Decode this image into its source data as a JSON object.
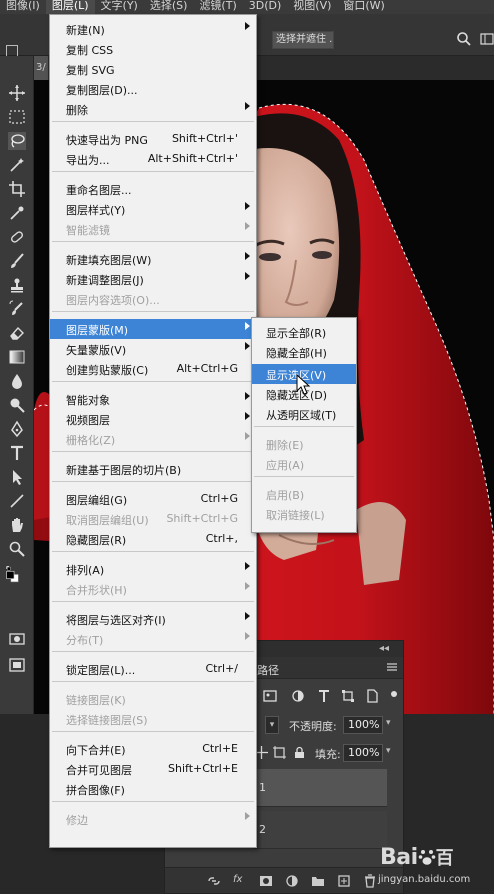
{
  "menubar": {
    "items": [
      "图像(I)",
      "图层(L)",
      "文字(Y)",
      "选择(S)",
      "滤镜(T)",
      "3D(D)",
      "视图(V)",
      "窗口(W)"
    ]
  },
  "options": {
    "select_and_mask_label": "选择并遮住 ..."
  },
  "document_tab_partial": "3/",
  "layer_menu": {
    "items": [
      {
        "label": "新建(N)",
        "shortcut": "",
        "submenu": true,
        "disabled": false
      },
      {
        "label": "复制 CSS",
        "shortcut": "",
        "submenu": false,
        "disabled": false
      },
      {
        "label": "复制 SVG",
        "shortcut": "",
        "submenu": false,
        "disabled": false
      },
      {
        "label": "复制图层(D)...",
        "shortcut": "",
        "submenu": false,
        "disabled": false
      },
      {
        "label": "删除",
        "shortcut": "",
        "submenu": true,
        "disabled": false
      },
      {
        "label": "快速导出为 PNG",
        "shortcut": "Shift+Ctrl+'",
        "submenu": false,
        "disabled": false
      },
      {
        "label": "导出为...",
        "shortcut": "Alt+Shift+Ctrl+'",
        "submenu": false,
        "disabled": false
      },
      {
        "label": "重命名图层...",
        "shortcut": "",
        "submenu": false,
        "disabled": false
      },
      {
        "label": "图层样式(Y)",
        "shortcut": "",
        "submenu": true,
        "disabled": false
      },
      {
        "label": "智能滤镜",
        "shortcut": "",
        "submenu": true,
        "disabled": true
      },
      {
        "label": "新建填充图层(W)",
        "shortcut": "",
        "submenu": true,
        "disabled": false
      },
      {
        "label": "新建调整图层(J)",
        "shortcut": "",
        "submenu": true,
        "disabled": false
      },
      {
        "label": "图层内容选项(O)...",
        "shortcut": "",
        "submenu": false,
        "disabled": true
      },
      {
        "label": "图层蒙版(M)",
        "shortcut": "",
        "submenu": true,
        "disabled": false,
        "highlighted": true
      },
      {
        "label": "矢量蒙版(V)",
        "shortcut": "",
        "submenu": true,
        "disabled": false
      },
      {
        "label": "创建剪贴蒙版(C)",
        "shortcut": "Alt+Ctrl+G",
        "submenu": false,
        "disabled": false
      },
      {
        "label": "智能对象",
        "shortcut": "",
        "submenu": true,
        "disabled": false
      },
      {
        "label": "视频图层",
        "shortcut": "",
        "submenu": true,
        "disabled": false
      },
      {
        "label": "栅格化(Z)",
        "shortcut": "",
        "submenu": true,
        "disabled": true
      },
      {
        "label": "新建基于图层的切片(B)",
        "shortcut": "",
        "submenu": false,
        "disabled": false
      },
      {
        "label": "图层编组(G)",
        "shortcut": "Ctrl+G",
        "submenu": false,
        "disabled": false
      },
      {
        "label": "取消图层编组(U)",
        "shortcut": "Shift+Ctrl+G",
        "submenu": false,
        "disabled": true
      },
      {
        "label": "隐藏图层(R)",
        "shortcut": "Ctrl+,",
        "submenu": false,
        "disabled": false
      },
      {
        "label": "排列(A)",
        "shortcut": "",
        "submenu": true,
        "disabled": false
      },
      {
        "label": "合并形状(H)",
        "shortcut": "",
        "submenu": true,
        "disabled": true
      },
      {
        "label": "将图层与选区对齐(I)",
        "shortcut": "",
        "submenu": true,
        "disabled": false
      },
      {
        "label": "分布(T)",
        "shortcut": "",
        "submenu": true,
        "disabled": true
      },
      {
        "label": "锁定图层(L)...",
        "shortcut": "Ctrl+/",
        "submenu": false,
        "disabled": false
      },
      {
        "label": "链接图层(K)",
        "shortcut": "",
        "submenu": false,
        "disabled": true
      },
      {
        "label": "选择链接图层(S)",
        "shortcut": "",
        "submenu": false,
        "disabled": true
      },
      {
        "label": "向下合并(E)",
        "shortcut": "Ctrl+E",
        "submenu": false,
        "disabled": false
      },
      {
        "label": "合并可见图层",
        "shortcut": "Shift+Ctrl+E",
        "submenu": false,
        "disabled": false
      },
      {
        "label": "拼合图像(F)",
        "shortcut": "",
        "submenu": false,
        "disabled": false
      },
      {
        "label": "修边",
        "shortcut": "",
        "submenu": true,
        "disabled": true
      }
    ]
  },
  "mask_submenu": {
    "items": [
      {
        "label": "显示全部(R)",
        "disabled": false
      },
      {
        "label": "隐藏全部(H)",
        "disabled": false
      },
      {
        "label": "显示选区(V)",
        "disabled": false,
        "highlighted": true
      },
      {
        "label": "隐藏选区(D)",
        "disabled": false
      },
      {
        "label": "从透明区域(T)",
        "disabled": false
      },
      {
        "label": "删除(E)",
        "disabled": true
      },
      {
        "label": "应用(A)",
        "disabled": true
      },
      {
        "label": "启用(B)",
        "disabled": true
      },
      {
        "label": "取消链接(L)",
        "disabled": true
      }
    ]
  },
  "layers_panel": {
    "tab_label": "路径",
    "opacity_label": "不透明度:",
    "opacity_value": "100%",
    "fill_label": "填充:",
    "fill_value": "100%",
    "layers": [
      "1",
      "2"
    ],
    "footer_fx": "fx"
  },
  "watermark": {
    "brand": "Bai",
    "brand_suffix": "百",
    "url": "jingyan.baidu.com"
  },
  "colors": {
    "menu_bg": "#f1f1f1",
    "menu_highlight": "#3d84d6",
    "ui_dark": "#3a3a3a",
    "canvas_bg": "#060606",
    "hood_red": "#c8151c"
  }
}
